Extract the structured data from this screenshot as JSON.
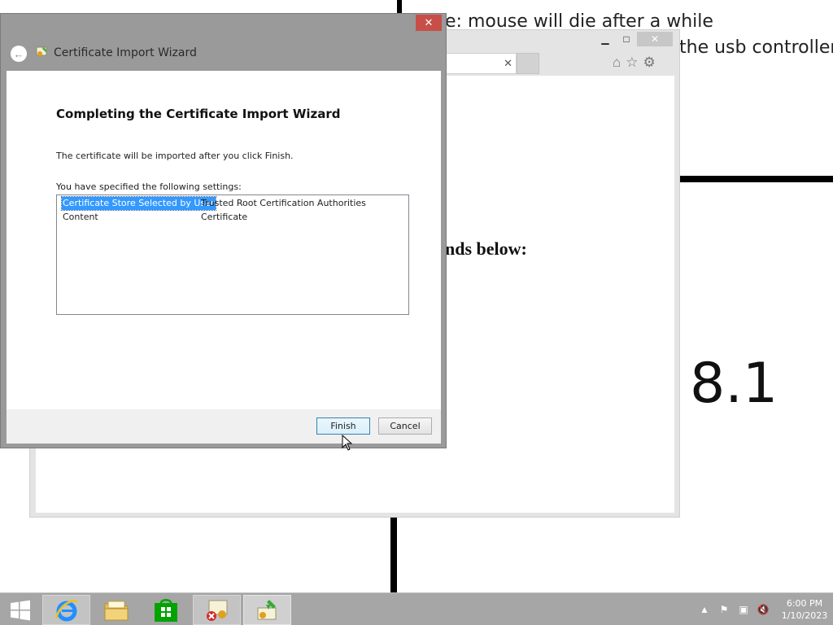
{
  "wallpaper": {
    "line1": "e: mouse will die after a while",
    "line2": "the usb controller",
    "version": "8.1"
  },
  "browser": {
    "heading_fragment": "nds below:"
  },
  "dialog": {
    "title": "Certificate Import Wizard",
    "heading": "Completing the Certificate Import Wizard",
    "info_text": "The certificate will be imported after you click Finish.",
    "settings_label": "You have specified the following settings:",
    "settings": [
      {
        "key": "Certificate Store Selected by User",
        "value": "Trusted Root Certification Authorities",
        "selected": true
      },
      {
        "key": "Content",
        "value": "Certificate",
        "selected": false
      }
    ],
    "finish_label": "Finish",
    "cancel_label": "Cancel"
  },
  "taskbar": {
    "items": [
      "start-icon",
      "internet-explorer-icon",
      "file-explorer-icon",
      "store-icon",
      "certificate-manager-icon",
      "certificate-import-wizard-icon"
    ],
    "clock_time": "6:00 PM",
    "clock_date": "1/10/2023"
  }
}
